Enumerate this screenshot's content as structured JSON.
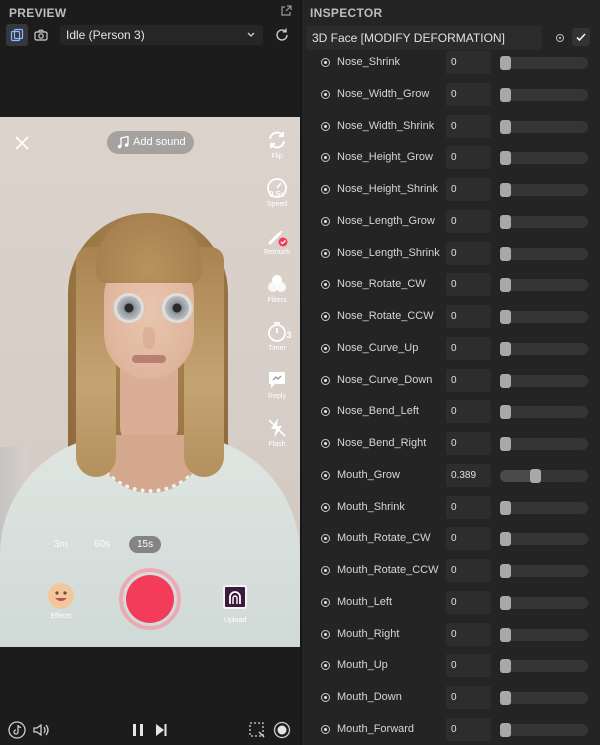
{
  "preview": {
    "title": "PREVIEW",
    "scene_select": "Idle (Person 3)",
    "overlay": {
      "add_sound": "Add sound",
      "side_buttons": [
        {
          "label": "Flip",
          "icon": "flip-icon"
        },
        {
          "label": "Speed",
          "icon": "speed-icon"
        },
        {
          "label": "Retouch",
          "icon": "retouch-icon"
        },
        {
          "label": "Filters",
          "icon": "filters-icon"
        },
        {
          "label": "Timer",
          "icon": "timer-icon"
        },
        {
          "label": "Reply",
          "icon": "reply-icon"
        },
        {
          "label": "Flash",
          "icon": "flash-icon"
        }
      ],
      "speed_badge": "0.5x",
      "timer_badge": "3",
      "durations": [
        "3m",
        "60s",
        "15s"
      ],
      "selected_duration": "15s",
      "effects_label": "Effects",
      "upload_label": "Upload",
      "record_color": "#f23c5a"
    }
  },
  "inspector": {
    "title": "INSPECTOR",
    "object_name": "3D Face [MODIFY DEFORMATION]",
    "rows": [
      {
        "label": "Nose_Shrink",
        "value": "0",
        "fraction": 0
      },
      {
        "label": "Nose_Width_Grow",
        "value": "0",
        "fraction": 0
      },
      {
        "label": "Nose_Width_Shrink",
        "value": "0",
        "fraction": 0
      },
      {
        "label": "Nose_Height_Grow",
        "value": "0",
        "fraction": 0
      },
      {
        "label": "Nose_Height_Shrink",
        "value": "0",
        "fraction": 0
      },
      {
        "label": "Nose_Length_Grow",
        "value": "0",
        "fraction": 0
      },
      {
        "label": "Nose_Length_Shrink",
        "value": "0",
        "fraction": 0
      },
      {
        "label": "Nose_Rotate_CW",
        "value": "0",
        "fraction": 0
      },
      {
        "label": "Nose_Rotate_CCW",
        "value": "0",
        "fraction": 0
      },
      {
        "label": "Nose_Curve_Up",
        "value": "0",
        "fraction": 0
      },
      {
        "label": "Nose_Curve_Down",
        "value": "0",
        "fraction": 0
      },
      {
        "label": "Nose_Bend_Left",
        "value": "0",
        "fraction": 0
      },
      {
        "label": "Nose_Bend_Right",
        "value": "0",
        "fraction": 0
      },
      {
        "label": "Mouth_Grow",
        "value": "0.389",
        "fraction": 0.389
      },
      {
        "label": "Mouth_Shrink",
        "value": "0",
        "fraction": 0
      },
      {
        "label": "Mouth_Rotate_CW",
        "value": "0",
        "fraction": 0
      },
      {
        "label": "Mouth_Rotate_CCW",
        "value": "0",
        "fraction": 0
      },
      {
        "label": "Mouth_Left",
        "value": "0",
        "fraction": 0
      },
      {
        "label": "Mouth_Right",
        "value": "0",
        "fraction": 0
      },
      {
        "label": "Mouth_Up",
        "value": "0",
        "fraction": 0
      },
      {
        "label": "Mouth_Down",
        "value": "0",
        "fraction": 0
      },
      {
        "label": "Mouth_Forward",
        "value": "0",
        "fraction": 0
      }
    ]
  }
}
